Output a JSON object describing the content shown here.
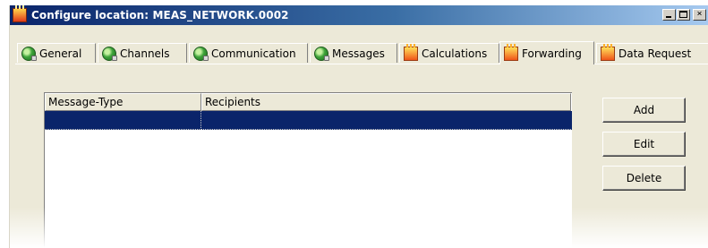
{
  "window": {
    "title": "Configure location: MEAS_NETWORK.0002",
    "controls": {
      "minimize": "_",
      "maximize": "",
      "close": "×"
    }
  },
  "tabs": [
    {
      "label": "General",
      "icon": "globe-icon",
      "active": false
    },
    {
      "label": "Channels",
      "icon": "globe-icon",
      "active": false
    },
    {
      "label": "Communication",
      "icon": "globe-icon",
      "active": false
    },
    {
      "label": "Messages",
      "icon": "globe-icon",
      "active": false
    },
    {
      "label": "Calculations",
      "icon": "calculations-icon",
      "active": false
    },
    {
      "label": "Forwarding",
      "icon": "forwarding-icon",
      "active": true
    },
    {
      "label": "Data Request",
      "icon": "data-request-icon",
      "active": false
    }
  ],
  "table": {
    "columns": [
      "Message-Type",
      "Recipients"
    ],
    "rows": [
      {
        "message_type": "",
        "recipients": "",
        "selected": true
      }
    ],
    "selection_color": "#0a246a"
  },
  "buttons": {
    "add": "Add",
    "edit": "Edit",
    "delete": "Delete"
  }
}
